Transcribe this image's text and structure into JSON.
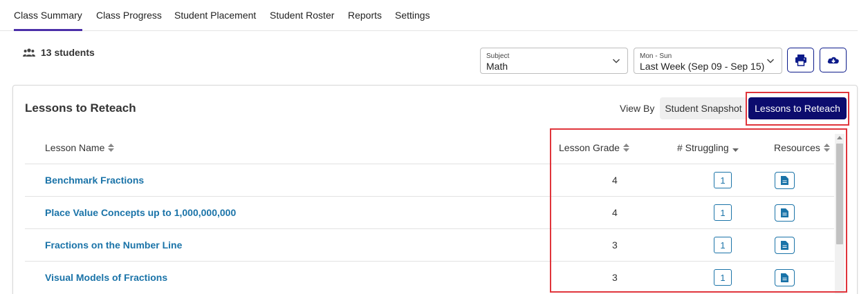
{
  "tabs": [
    {
      "label": "Class Summary",
      "active": true
    },
    {
      "label": "Class Progress"
    },
    {
      "label": "Student Placement"
    },
    {
      "label": "Student Roster"
    },
    {
      "label": "Reports"
    },
    {
      "label": "Settings"
    }
  ],
  "students": {
    "label": "13 students",
    "icon": "people-icon"
  },
  "filters": {
    "subject": {
      "label": "Subject",
      "value": "Math"
    },
    "date": {
      "label": "Mon - Sun",
      "value": "Last Week (Sep 09 - Sep 15)"
    }
  },
  "card": {
    "title": "Lessons to Reteach",
    "view_by": "View By",
    "segments": [
      "Student Snapshot",
      "Lessons to Reteach"
    ]
  },
  "table": {
    "columns": [
      "Lesson Name",
      "Lesson Grade",
      "# Struggling",
      "Resources"
    ],
    "rows": [
      {
        "name": "Benchmark Fractions",
        "grade": "4",
        "struggling": "1"
      },
      {
        "name": "Place Value Concepts up to 1,000,000,000",
        "grade": "4",
        "struggling": "1"
      },
      {
        "name": "Fractions on the Number Line",
        "grade": "3",
        "struggling": "1"
      },
      {
        "name": "Visual Models of Fractions",
        "grade": "3",
        "struggling": "1"
      }
    ]
  },
  "colors": {
    "accent": "#4b2fa8",
    "primary_dark": "#0c0c6e",
    "link": "#1a73a8",
    "highlight": "#e0343b"
  }
}
